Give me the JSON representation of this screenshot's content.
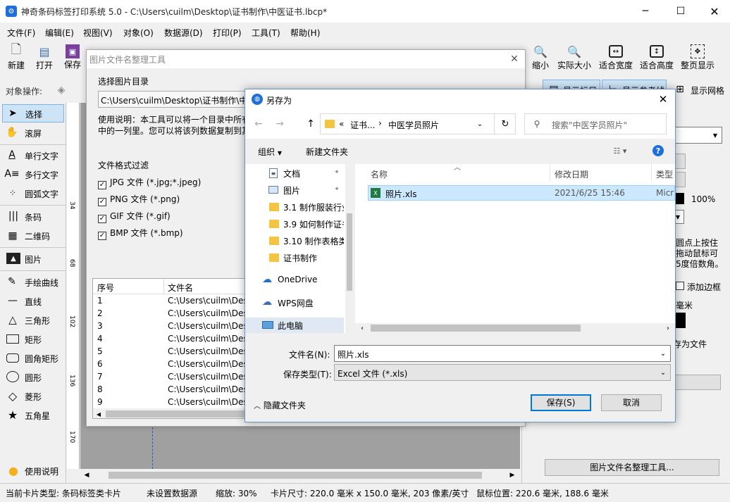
{
  "app": {
    "title": "神奇条码标签打印系统 5.0 - C:\\Users\\cuilm\\Desktop\\证书制作\\中医证书.lbcp*"
  },
  "menu": [
    "文件(F)",
    "编辑(E)",
    "视图(V)",
    "对象(O)",
    "数据源(D)",
    "打印(P)",
    "工具(T)",
    "帮助(H)"
  ],
  "toolbar": {
    "left": [
      "新建",
      "打开",
      "保存"
    ],
    "right": [
      "缩小",
      "实际大小",
      "适合宽度",
      "适合高度",
      "整页显示"
    ]
  },
  "object_bar": {
    "label": "对象操作:",
    "right_btn1": "显示标尺",
    "right_btn2": "显示参考线",
    "grid": "显示网格"
  },
  "tools": [
    "选择",
    "滚屏",
    "单行文字",
    "多行文字",
    "圆弧文字",
    "条码",
    "二维码",
    "图片",
    "手绘曲线",
    "直线",
    "三角形",
    "矩形",
    "圆角矩形",
    "圆形",
    "菱形",
    "五角星"
  ],
  "tools_help": "使用说明",
  "ruler": [
    "34",
    "68",
    "102",
    "136",
    "170"
  ],
  "right_panel": {
    "zoom": "100%",
    "note1": "圆点上按住",
    "note2": "拖动鼠标可",
    "note3": "5度倍数角。",
    "add_border": "添加边框",
    "unit": "毫米",
    "save_as_file": "存为文件",
    "organizer_btn": "图片文件名整理工具..."
  },
  "status": {
    "card_type": "当前卡片类型: 条码标签类卡片",
    "datasource": "未设置数据源",
    "zoom": "缩放: 30%",
    "card_size": "卡片尺寸: 220.0 毫米 x 150.0 毫米, 203 像素/英寸",
    "mouse": "鼠标位置: 220.6 毫米, 188.6 毫米"
  },
  "organizer": {
    "title": "图片文件名整理工具",
    "dir_label": "选择图片目录",
    "dir_value": "C:\\Users\\cuilm\\Desktop\\证书制作\\中医",
    "help1": "使用说明：本工具可以将一个目录中所有",
    "help2": "中的一列里。您可以将该列数据复制到其",
    "filter_label": "文件格式过滤",
    "filters": [
      "JPG 文件 (*.jpg;*.jpeg)",
      "PNG 文件 (*.png)",
      "GIF 文件 (*.gif)",
      "BMP 文件 (*.bmp)"
    ],
    "col_no": "序号",
    "col_name": "文件名",
    "rows": [
      {
        "n": "1",
        "f": "C:\\Users\\cuilm\\Desk"
      },
      {
        "n": "2",
        "f": "C:\\Users\\cuilm\\Desk"
      },
      {
        "n": "3",
        "f": "C:\\Users\\cuilm\\Desk"
      },
      {
        "n": "4",
        "f": "C:\\Users\\cuilm\\Desk"
      },
      {
        "n": "5",
        "f": "C:\\Users\\cuilm\\Desk"
      },
      {
        "n": "6",
        "f": "C:\\Users\\cuilm\\Desk"
      },
      {
        "n": "7",
        "f": "C:\\Users\\cuilm\\Desk"
      },
      {
        "n": "8",
        "f": "C:\\Users\\cuilm\\Desk"
      },
      {
        "n": "9",
        "f": "C:\\Users\\cuilm\\Desk"
      }
    ]
  },
  "saveas": {
    "title": "另存为",
    "crumb_root": "«",
    "crumb1": "证书...",
    "crumb2": "中医学员照片",
    "search_placeholder": "搜索\"中医学员照片\"",
    "organize": "组织",
    "new_folder": "新建文件夹",
    "nav": [
      "文档",
      "图片",
      "3.1 制作服装行业",
      "3.9 如何制作证书",
      "3.10 制作表格类",
      "证书制作",
      "OneDrive",
      "WPS网盘",
      "此电脑"
    ],
    "col_name": "名称",
    "col_date": "修改日期",
    "col_type": "类型",
    "file": {
      "name": "照片.xls",
      "date": "2021/6/25 15:46",
      "type": "Micr"
    },
    "filename_label": "文件名(N):",
    "filename_value": "照片.xls",
    "type_label": "保存类型(T):",
    "type_value": "Excel 文件 (*.xls)",
    "hide_folders": "隐藏文件夹",
    "save": "保存(S)",
    "cancel": "取消"
  }
}
